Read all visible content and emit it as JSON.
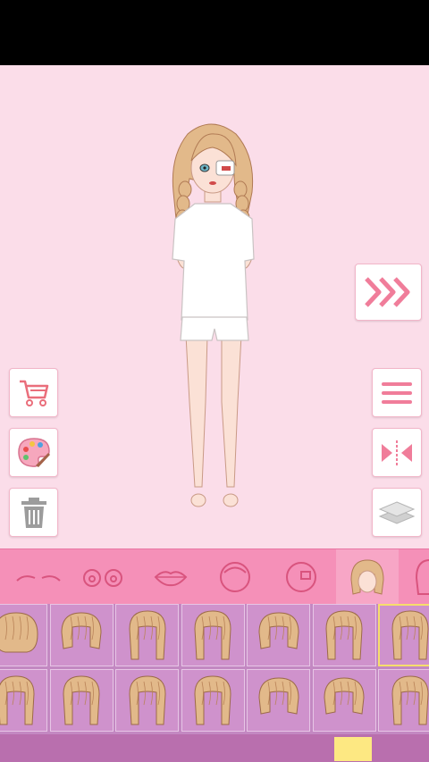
{
  "app": {
    "name": "dress-up game"
  },
  "colors": {
    "stage": "#fbdde9",
    "category_bar": "#f590b8",
    "item_grid": "#c388c2",
    "selection": "#f6de6b",
    "hair": "#e2b98a"
  },
  "side_buttons": {
    "left": [
      {
        "name": "shop",
        "icon": "cart-icon"
      },
      {
        "name": "palette",
        "icon": "palette-icon"
      },
      {
        "name": "delete",
        "icon": "trash-icon"
      }
    ],
    "right": [
      {
        "name": "next",
        "icon": "triple-chevron-right-icon"
      },
      {
        "name": "menu",
        "icon": "hamburger-menu-icon"
      },
      {
        "name": "flip",
        "icon": "mirror-flip-icon"
      },
      {
        "name": "layers",
        "icon": "layers-icon"
      }
    ]
  },
  "categories": [
    {
      "name": "eyebrows",
      "icon": "eyebrows-icon",
      "selected": false
    },
    {
      "name": "eyes",
      "icon": "eyes-icon",
      "selected": false
    },
    {
      "name": "lips",
      "icon": "lips-icon",
      "selected": false
    },
    {
      "name": "face",
      "icon": "face-icon",
      "selected": false
    },
    {
      "name": "face-accessory",
      "icon": "face-accessory-icon",
      "selected": false
    },
    {
      "name": "hair",
      "icon": "hair-icon",
      "selected": true
    },
    {
      "name": "back-hair",
      "icon": "back-hair-icon",
      "selected": false
    }
  ],
  "hair_items": {
    "selected_index": 6,
    "rows": [
      [
        "curly-short",
        "bob-center-part",
        "bangs-long",
        "long-straight",
        "layered-medium",
        "wavy-long",
        "braids"
      ],
      [
        "side-ponytail",
        "wavy-bangs",
        "low-pigtails",
        "wavy-medium",
        "shoulder-layered",
        "short-bob",
        "braids-thin"
      ]
    ]
  },
  "pager": {
    "current_page": 5
  }
}
